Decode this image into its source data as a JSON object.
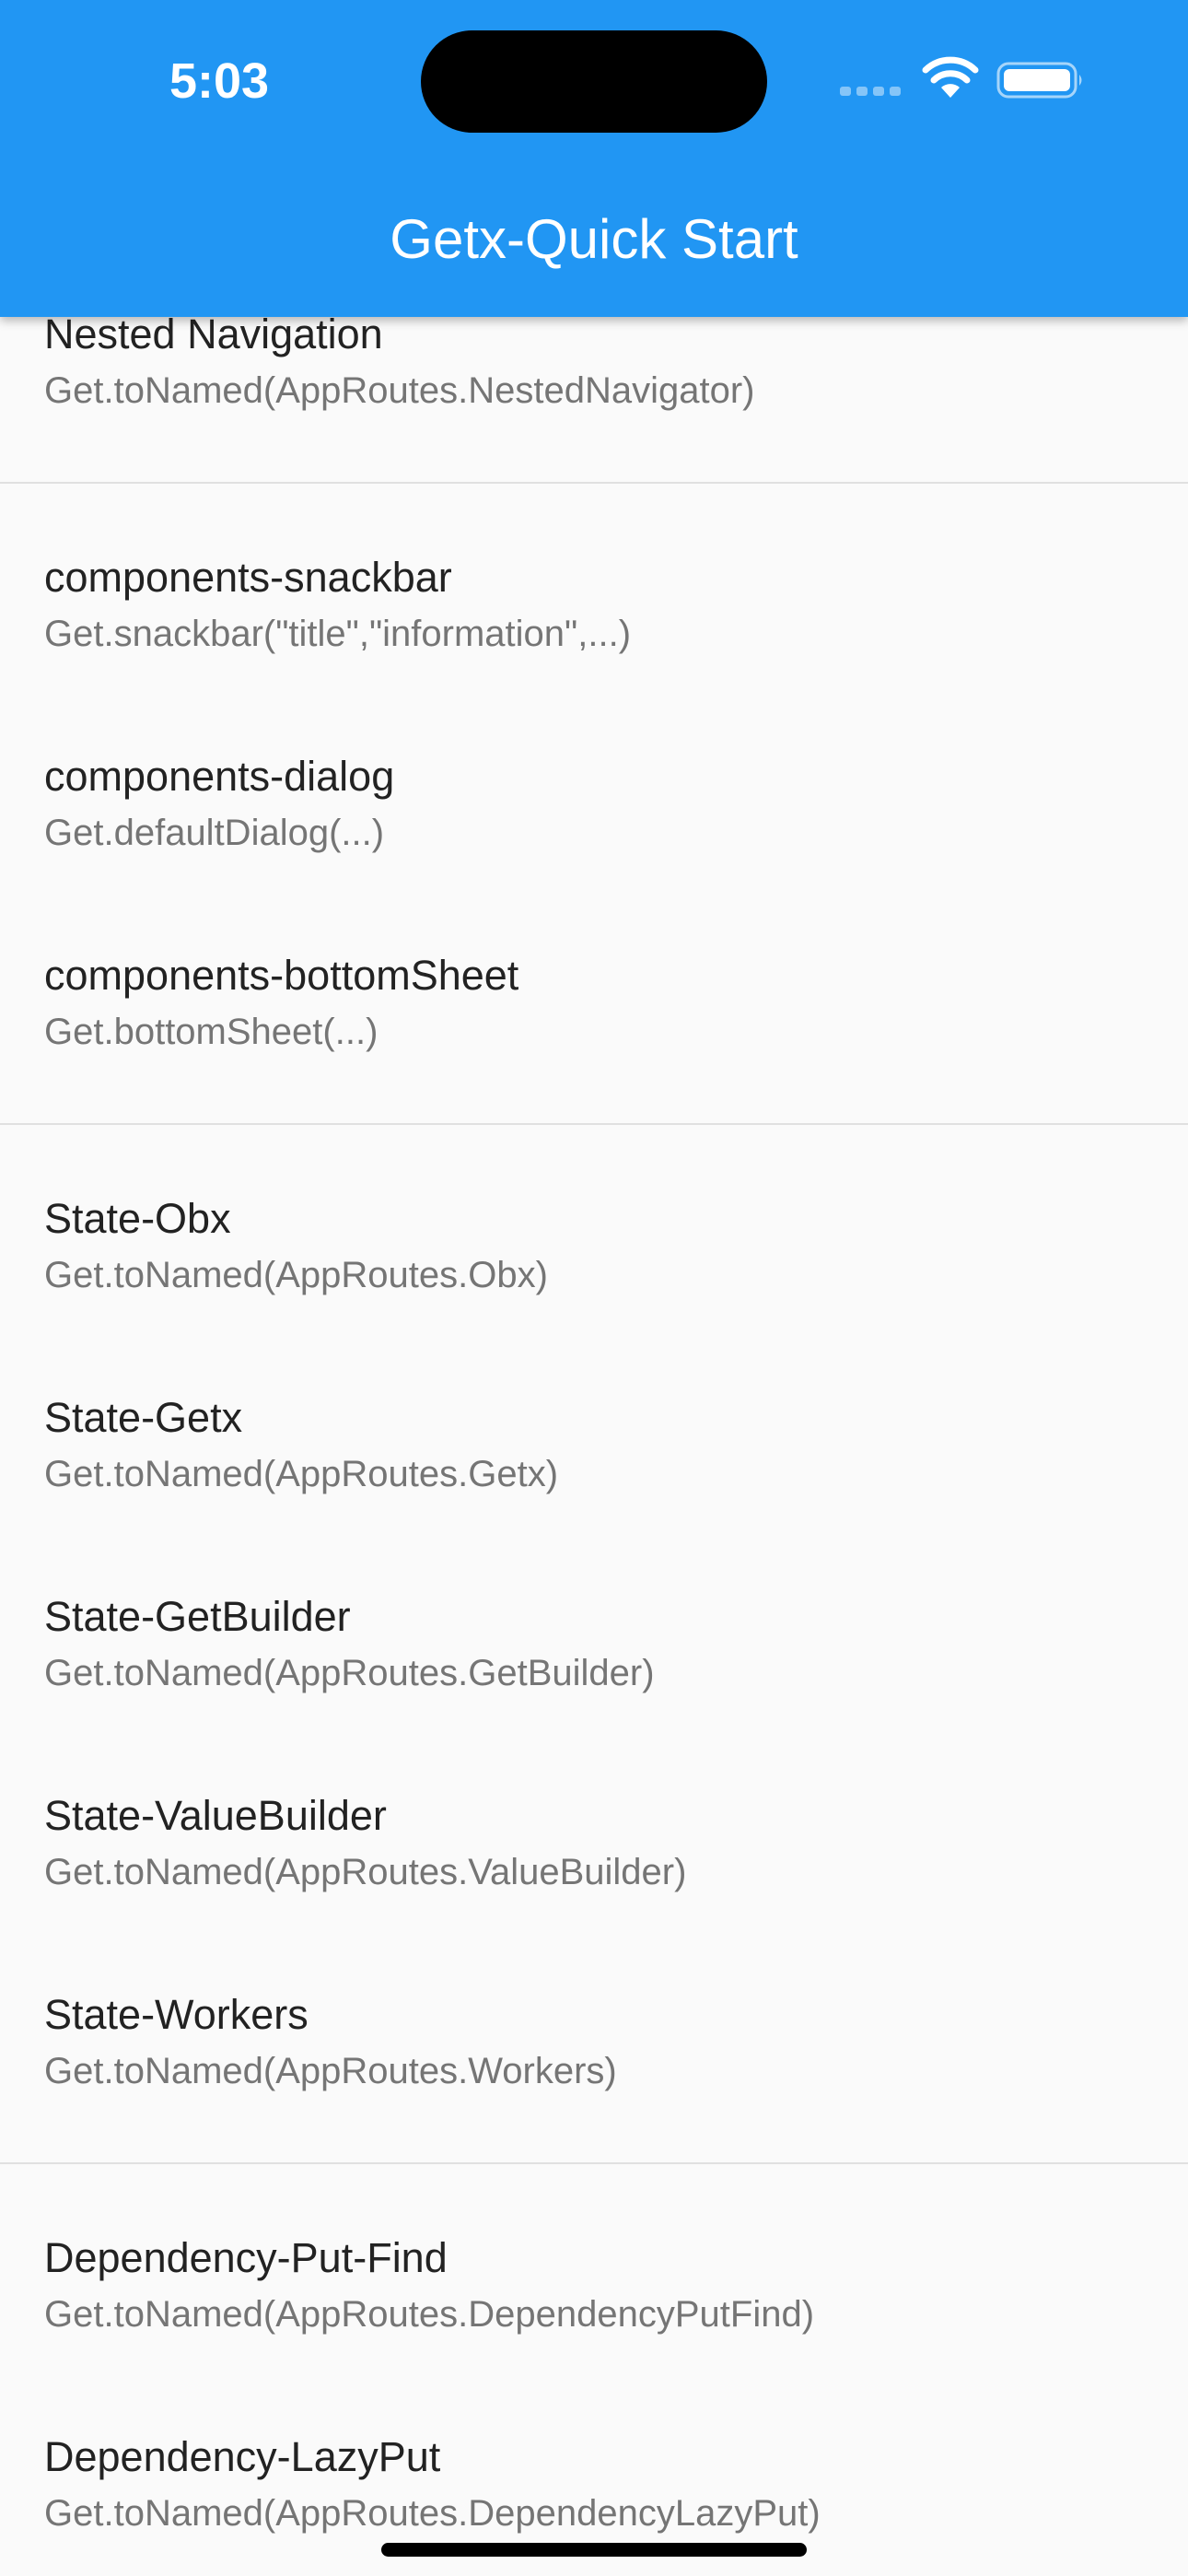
{
  "status_bar": {
    "time": "5:03"
  },
  "app_bar": {
    "title": "Getx-Quick Start",
    "color": "#2196F3"
  },
  "list": {
    "items": [
      {
        "title": "Nested Navigation",
        "subtitle": "Get.toNamed(AppRoutes.NestedNavigator)"
      },
      {
        "title": "components-snackbar",
        "subtitle": "Get.snackbar(\"title\",\"information\",...)"
      },
      {
        "title": "components-dialog",
        "subtitle": "Get.defaultDialog(...)"
      },
      {
        "title": "components-bottomSheet",
        "subtitle": "Get.bottomSheet(...)"
      },
      {
        "title": "State-Obx",
        "subtitle": "Get.toNamed(AppRoutes.Obx)"
      },
      {
        "title": "State-Getx",
        "subtitle": "Get.toNamed(AppRoutes.Getx)"
      },
      {
        "title": "State-GetBuilder",
        "subtitle": "Get.toNamed(AppRoutes.GetBuilder)"
      },
      {
        "title": "State-ValueBuilder",
        "subtitle": "Get.toNamed(AppRoutes.ValueBuilder)"
      },
      {
        "title": "State-Workers",
        "subtitle": "Get.toNamed(AppRoutes.Workers)"
      },
      {
        "title": "Dependency-Put-Find",
        "subtitle": "Get.toNamed(AppRoutes.DependencyPutFind)"
      },
      {
        "title": "Dependency-LazyPut",
        "subtitle": "Get.toNamed(AppRoutes.DependencyLazyPut)"
      }
    ]
  }
}
